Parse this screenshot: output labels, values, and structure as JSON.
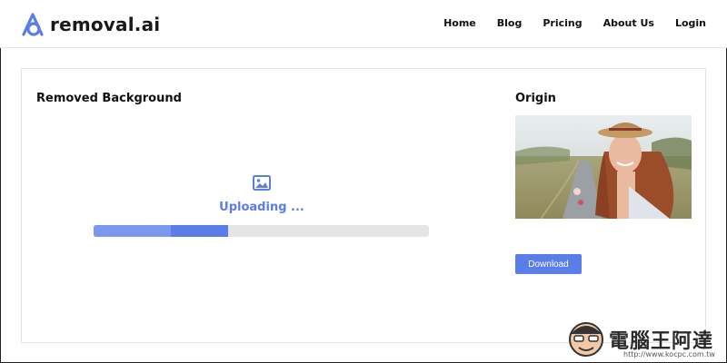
{
  "header": {
    "logo_text": "removal.ai",
    "nav": [
      "Home",
      "Blog",
      "Pricing",
      "About Us",
      "Login"
    ]
  },
  "main": {
    "removed_title": "Removed Background",
    "origin_title": "Origin",
    "upload_status": "Uploading ...",
    "progress_fraction": 0.4,
    "download_label": "Download"
  },
  "watermark": {
    "text": "電腦王阿達",
    "url": "http://www.kocpc.com.tw"
  },
  "colors": {
    "accent": "#5b7de8",
    "progress_track": "#e5e5e5"
  },
  "icons": [
    "removal-ai-logo-icon",
    "image-icon"
  ]
}
